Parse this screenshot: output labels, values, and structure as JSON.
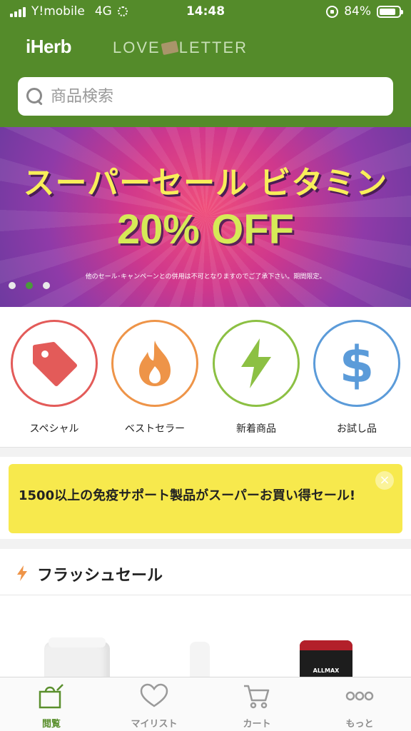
{
  "status_bar": {
    "carrier": "Y!mobile",
    "network": "4G",
    "time": "14:48",
    "battery": "84%",
    "battery_level": 0.84
  },
  "header": {
    "logo": "iHerb",
    "partner_logo_left": "LOVE",
    "partner_logo_right": "LETTER",
    "color": "#548b2a"
  },
  "search": {
    "placeholder": "商品検索"
  },
  "banner": {
    "title": "スーパーセール ビタミン",
    "discount": "20% OFF",
    "note": "他のセール･キャンペーンとの併用は不可となりますのでご了承下さい。期間限定。",
    "slide_count": 3,
    "active_slide": 2
  },
  "categories": [
    {
      "label": "スペシャル",
      "icon": "tag-icon",
      "color": "#e35b59"
    },
    {
      "label": "ベストセラー",
      "icon": "flame-icon",
      "color": "#ee9448"
    },
    {
      "label": "新着商品",
      "icon": "lightning-icon",
      "color": "#8cc043"
    },
    {
      "label": "お試し品",
      "icon": "dollar-icon",
      "color": "#5b9bd9"
    }
  ],
  "promo": {
    "text": "1500以上の免疫サポート製品がスーパーお買い得セール!",
    "close": "×",
    "color": "#f7e94d"
  },
  "flash_sale": {
    "title": "フラッシュセール"
  },
  "products": {
    "third_brand": "ALLMAX"
  },
  "tabbar": {
    "tabs": [
      {
        "label": "閲覧",
        "icon": "shopping-bag-icon",
        "active": true
      },
      {
        "label": "マイリスト",
        "icon": "heart-icon",
        "active": false
      },
      {
        "label": "カート",
        "icon": "cart-icon",
        "active": false
      },
      {
        "label": "もっと",
        "icon": "more-icon",
        "active": false
      }
    ]
  }
}
